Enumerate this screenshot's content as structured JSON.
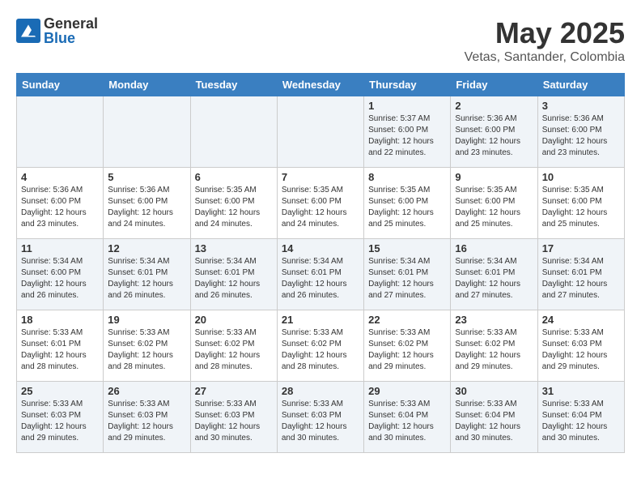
{
  "header": {
    "logo_general": "General",
    "logo_blue": "Blue",
    "month": "May 2025",
    "location": "Vetas, Santander, Colombia"
  },
  "weekdays": [
    "Sunday",
    "Monday",
    "Tuesday",
    "Wednesday",
    "Thursday",
    "Friday",
    "Saturday"
  ],
  "weeks": [
    [
      {
        "day": "",
        "info": ""
      },
      {
        "day": "",
        "info": ""
      },
      {
        "day": "",
        "info": ""
      },
      {
        "day": "",
        "info": ""
      },
      {
        "day": "1",
        "info": "Sunrise: 5:37 AM\nSunset: 6:00 PM\nDaylight: 12 hours\nand 22 minutes."
      },
      {
        "day": "2",
        "info": "Sunrise: 5:36 AM\nSunset: 6:00 PM\nDaylight: 12 hours\nand 23 minutes."
      },
      {
        "day": "3",
        "info": "Sunrise: 5:36 AM\nSunset: 6:00 PM\nDaylight: 12 hours\nand 23 minutes."
      }
    ],
    [
      {
        "day": "4",
        "info": "Sunrise: 5:36 AM\nSunset: 6:00 PM\nDaylight: 12 hours\nand 23 minutes."
      },
      {
        "day": "5",
        "info": "Sunrise: 5:36 AM\nSunset: 6:00 PM\nDaylight: 12 hours\nand 24 minutes."
      },
      {
        "day": "6",
        "info": "Sunrise: 5:35 AM\nSunset: 6:00 PM\nDaylight: 12 hours\nand 24 minutes."
      },
      {
        "day": "7",
        "info": "Sunrise: 5:35 AM\nSunset: 6:00 PM\nDaylight: 12 hours\nand 24 minutes."
      },
      {
        "day": "8",
        "info": "Sunrise: 5:35 AM\nSunset: 6:00 PM\nDaylight: 12 hours\nand 25 minutes."
      },
      {
        "day": "9",
        "info": "Sunrise: 5:35 AM\nSunset: 6:00 PM\nDaylight: 12 hours\nand 25 minutes."
      },
      {
        "day": "10",
        "info": "Sunrise: 5:35 AM\nSunset: 6:00 PM\nDaylight: 12 hours\nand 25 minutes."
      }
    ],
    [
      {
        "day": "11",
        "info": "Sunrise: 5:34 AM\nSunset: 6:00 PM\nDaylight: 12 hours\nand 26 minutes."
      },
      {
        "day": "12",
        "info": "Sunrise: 5:34 AM\nSunset: 6:01 PM\nDaylight: 12 hours\nand 26 minutes."
      },
      {
        "day": "13",
        "info": "Sunrise: 5:34 AM\nSunset: 6:01 PM\nDaylight: 12 hours\nand 26 minutes."
      },
      {
        "day": "14",
        "info": "Sunrise: 5:34 AM\nSunset: 6:01 PM\nDaylight: 12 hours\nand 26 minutes."
      },
      {
        "day": "15",
        "info": "Sunrise: 5:34 AM\nSunset: 6:01 PM\nDaylight: 12 hours\nand 27 minutes."
      },
      {
        "day": "16",
        "info": "Sunrise: 5:34 AM\nSunset: 6:01 PM\nDaylight: 12 hours\nand 27 minutes."
      },
      {
        "day": "17",
        "info": "Sunrise: 5:34 AM\nSunset: 6:01 PM\nDaylight: 12 hours\nand 27 minutes."
      }
    ],
    [
      {
        "day": "18",
        "info": "Sunrise: 5:33 AM\nSunset: 6:01 PM\nDaylight: 12 hours\nand 28 minutes."
      },
      {
        "day": "19",
        "info": "Sunrise: 5:33 AM\nSunset: 6:02 PM\nDaylight: 12 hours\nand 28 minutes."
      },
      {
        "day": "20",
        "info": "Sunrise: 5:33 AM\nSunset: 6:02 PM\nDaylight: 12 hours\nand 28 minutes."
      },
      {
        "day": "21",
        "info": "Sunrise: 5:33 AM\nSunset: 6:02 PM\nDaylight: 12 hours\nand 28 minutes."
      },
      {
        "day": "22",
        "info": "Sunrise: 5:33 AM\nSunset: 6:02 PM\nDaylight: 12 hours\nand 29 minutes."
      },
      {
        "day": "23",
        "info": "Sunrise: 5:33 AM\nSunset: 6:02 PM\nDaylight: 12 hours\nand 29 minutes."
      },
      {
        "day": "24",
        "info": "Sunrise: 5:33 AM\nSunset: 6:03 PM\nDaylight: 12 hours\nand 29 minutes."
      }
    ],
    [
      {
        "day": "25",
        "info": "Sunrise: 5:33 AM\nSunset: 6:03 PM\nDaylight: 12 hours\nand 29 minutes."
      },
      {
        "day": "26",
        "info": "Sunrise: 5:33 AM\nSunset: 6:03 PM\nDaylight: 12 hours\nand 29 minutes."
      },
      {
        "day": "27",
        "info": "Sunrise: 5:33 AM\nSunset: 6:03 PM\nDaylight: 12 hours\nand 30 minutes."
      },
      {
        "day": "28",
        "info": "Sunrise: 5:33 AM\nSunset: 6:03 PM\nDaylight: 12 hours\nand 30 minutes."
      },
      {
        "day": "29",
        "info": "Sunrise: 5:33 AM\nSunset: 6:04 PM\nDaylight: 12 hours\nand 30 minutes."
      },
      {
        "day": "30",
        "info": "Sunrise: 5:33 AM\nSunset: 6:04 PM\nDaylight: 12 hours\nand 30 minutes."
      },
      {
        "day": "31",
        "info": "Sunrise: 5:33 AM\nSunset: 6:04 PM\nDaylight: 12 hours\nand 30 minutes."
      }
    ]
  ]
}
